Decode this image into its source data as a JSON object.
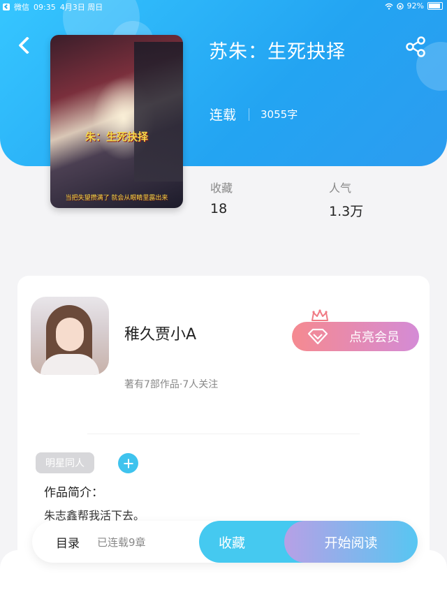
{
  "status_bar": {
    "app": "微信",
    "time": "09:35",
    "date": "4月3日 周日",
    "battery": "92%"
  },
  "book": {
    "title": "苏朱：生死抉择",
    "status": "连载",
    "word_count": "3055字",
    "cover": {
      "title_art": "朱：生死抉择",
      "caption": "当把失望攒满了 就会从眼睛里露出来"
    }
  },
  "stats": {
    "favorites": {
      "label": "收藏",
      "value": "18"
    },
    "popularity": {
      "label": "人气",
      "value": "1.3万"
    }
  },
  "author": {
    "name": "稚久贾小A",
    "meta": "著有7部作品·7人关注",
    "vip_label": "点亮会员"
  },
  "tags": [
    "明星同人"
  ],
  "intro": {
    "heading": "作品简介：",
    "text": "朱志鑫帮我活下去。"
  },
  "action_bar": {
    "toc_label": "目录",
    "chapter_count": "已连载9章",
    "favorite_label": "收藏",
    "read_label": "开始阅读"
  },
  "colors": {
    "header_gradient_start": "#36c6ff",
    "header_gradient_end": "#2c9cf0",
    "vip_gradient_start": "#f58a90",
    "vip_gradient_end": "#d48bd6",
    "favorite_button": "#45c9f0",
    "read_gradient_start": "#b7a0e6",
    "read_gradient_end": "#57c6f2"
  },
  "icons": [
    "back-icon",
    "share-icon",
    "crown-icon",
    "diamond-icon",
    "plus-icon",
    "wifi-icon",
    "battery-icon"
  ]
}
